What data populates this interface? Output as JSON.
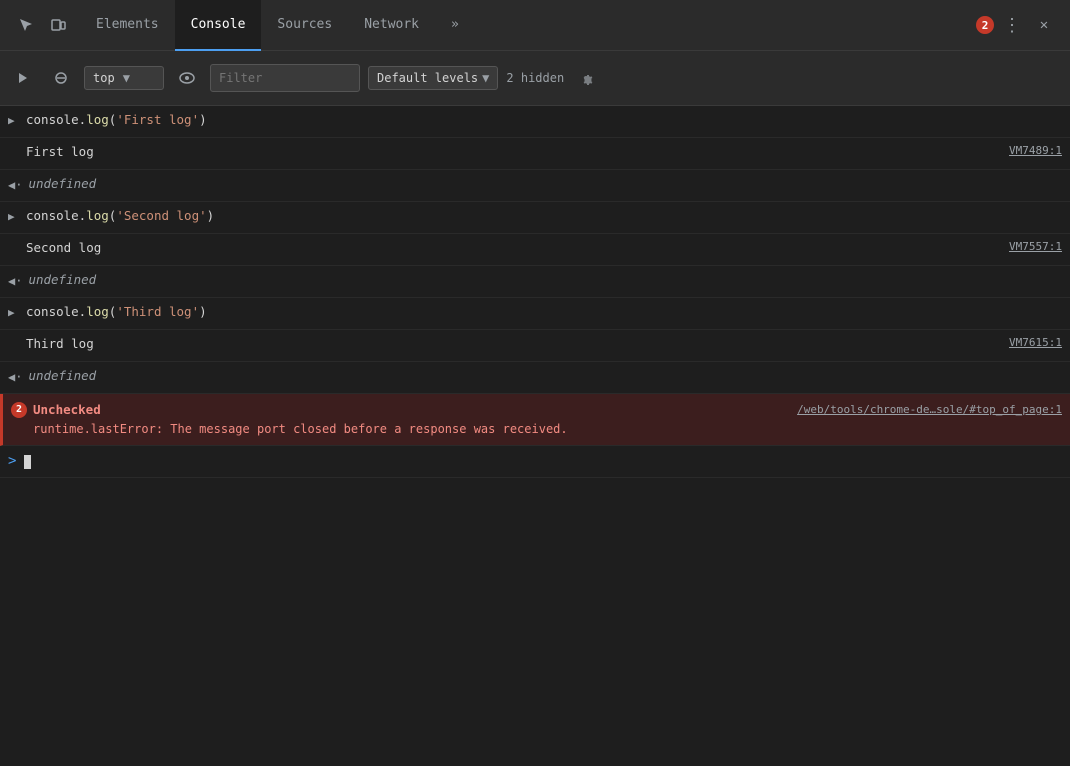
{
  "tabs": {
    "items": [
      {
        "label": "Elements",
        "active": false
      },
      {
        "label": "Console",
        "active": true
      },
      {
        "label": "Sources",
        "active": false
      },
      {
        "label": "Network",
        "active": false
      }
    ],
    "more_label": "»",
    "error_count": "2",
    "close_label": "✕"
  },
  "toolbar": {
    "context_value": "top",
    "filter_placeholder": "Filter",
    "levels_label": "Default levels",
    "hidden_label": "2 hidden"
  },
  "console": {
    "rows": [
      {
        "type": "input",
        "code_prefix": "console.log(",
        "code_string": "'First log'",
        "code_suffix": ")"
      },
      {
        "type": "output",
        "text": "First log",
        "link": "VM7489:1"
      },
      {
        "type": "undefined"
      },
      {
        "type": "input",
        "code_prefix": "console.log(",
        "code_string": "'Second log'",
        "code_suffix": ")"
      },
      {
        "type": "output",
        "text": "Second log",
        "link": "VM7557:1"
      },
      {
        "type": "undefined"
      },
      {
        "type": "input",
        "code_prefix": "console.log(",
        "code_string": "'Third log'",
        "code_suffix": ")"
      },
      {
        "type": "output",
        "text": "Third log",
        "link": "VM7615:1"
      },
      {
        "type": "undefined"
      },
      {
        "type": "error",
        "badge": "2",
        "title": "Unchecked",
        "link": "/web/tools/chrome-de…sole/#top_of_page:1",
        "message": "runtime.lastError: The message port closed before a response was received."
      }
    ],
    "prompt_symbol": ">"
  }
}
